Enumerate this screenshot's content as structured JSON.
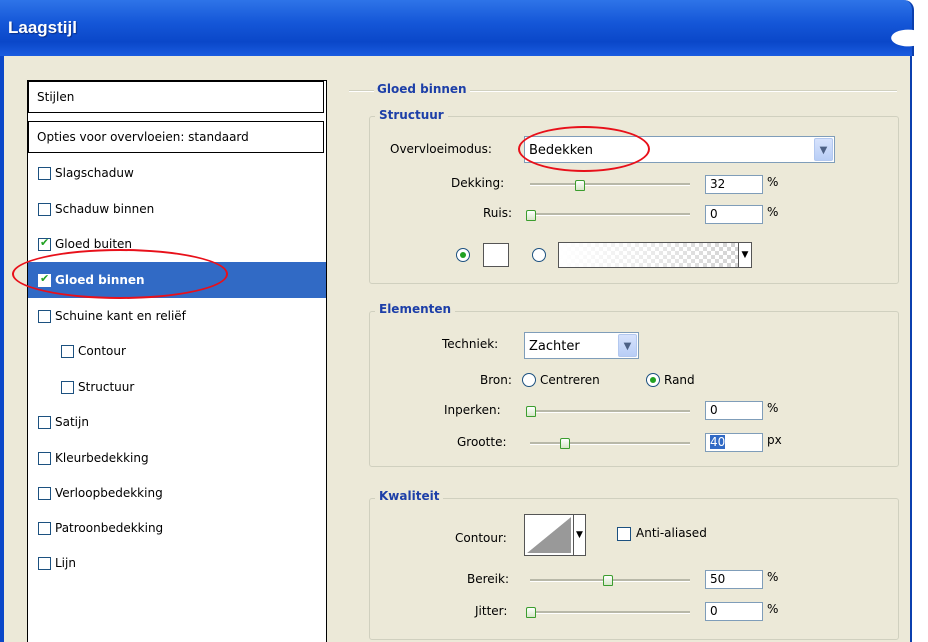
{
  "window": {
    "title": "Laagstijl"
  },
  "styles": {
    "header": "Stijlen",
    "blend_options": "Opties voor overvloeien: standaard",
    "items": [
      {
        "label": "Slagschaduw",
        "checked": false,
        "sub": false
      },
      {
        "label": "Schaduw binnen",
        "checked": false,
        "sub": false
      },
      {
        "label": "Gloed buiten",
        "checked": true,
        "sub": false
      },
      {
        "label": "Gloed binnen",
        "checked": true,
        "sub": false,
        "selected": true
      },
      {
        "label": "Schuine kant en reliëf",
        "checked": false,
        "sub": false
      },
      {
        "label": "Contour",
        "checked": false,
        "sub": true
      },
      {
        "label": "Structuur",
        "checked": false,
        "sub": true
      },
      {
        "label": "Satijn",
        "checked": false,
        "sub": false
      },
      {
        "label": "Kleurbedekking",
        "checked": false,
        "sub": false
      },
      {
        "label": "Verloopbedekking",
        "checked": false,
        "sub": false
      },
      {
        "label": "Patroonbedekking",
        "checked": false,
        "sub": false
      },
      {
        "label": "Lijn",
        "checked": false,
        "sub": false
      }
    ]
  },
  "panel": {
    "title": "Gloed binnen",
    "structure": {
      "legend": "Structuur",
      "blend_mode_label": "Overvloeimodus:",
      "blend_mode_value": "Bedekken",
      "opacity_label": "Dekking:",
      "opacity_value": "32",
      "opacity_unit": "%",
      "noise_label": "Ruis:",
      "noise_value": "0",
      "noise_unit": "%"
    },
    "elements": {
      "legend": "Elementen",
      "technique_label": "Techniek:",
      "technique_value": "Zachter",
      "source_label": "Bron:",
      "source_center": "Centreren",
      "source_edge": "Rand",
      "choke_label": "Inperken:",
      "choke_value": "0",
      "choke_unit": "%",
      "size_label": "Grootte:",
      "size_value": "40",
      "size_unit": "px"
    },
    "quality": {
      "legend": "Kwaliteit",
      "contour_label": "Contour:",
      "anti_aliased_label": "Anti-aliased",
      "range_label": "Bereik:",
      "range_value": "50",
      "range_unit": "%",
      "jitter_label": "Jitter:",
      "jitter_value": "0",
      "jitter_unit": "%"
    }
  },
  "colors": {
    "title_bar": "#0a47c9",
    "selection": "#316ac5",
    "dialog_bg": "#ece9d8",
    "section_title": "#1d3fa8",
    "highlight_oval": "#e8101a"
  }
}
